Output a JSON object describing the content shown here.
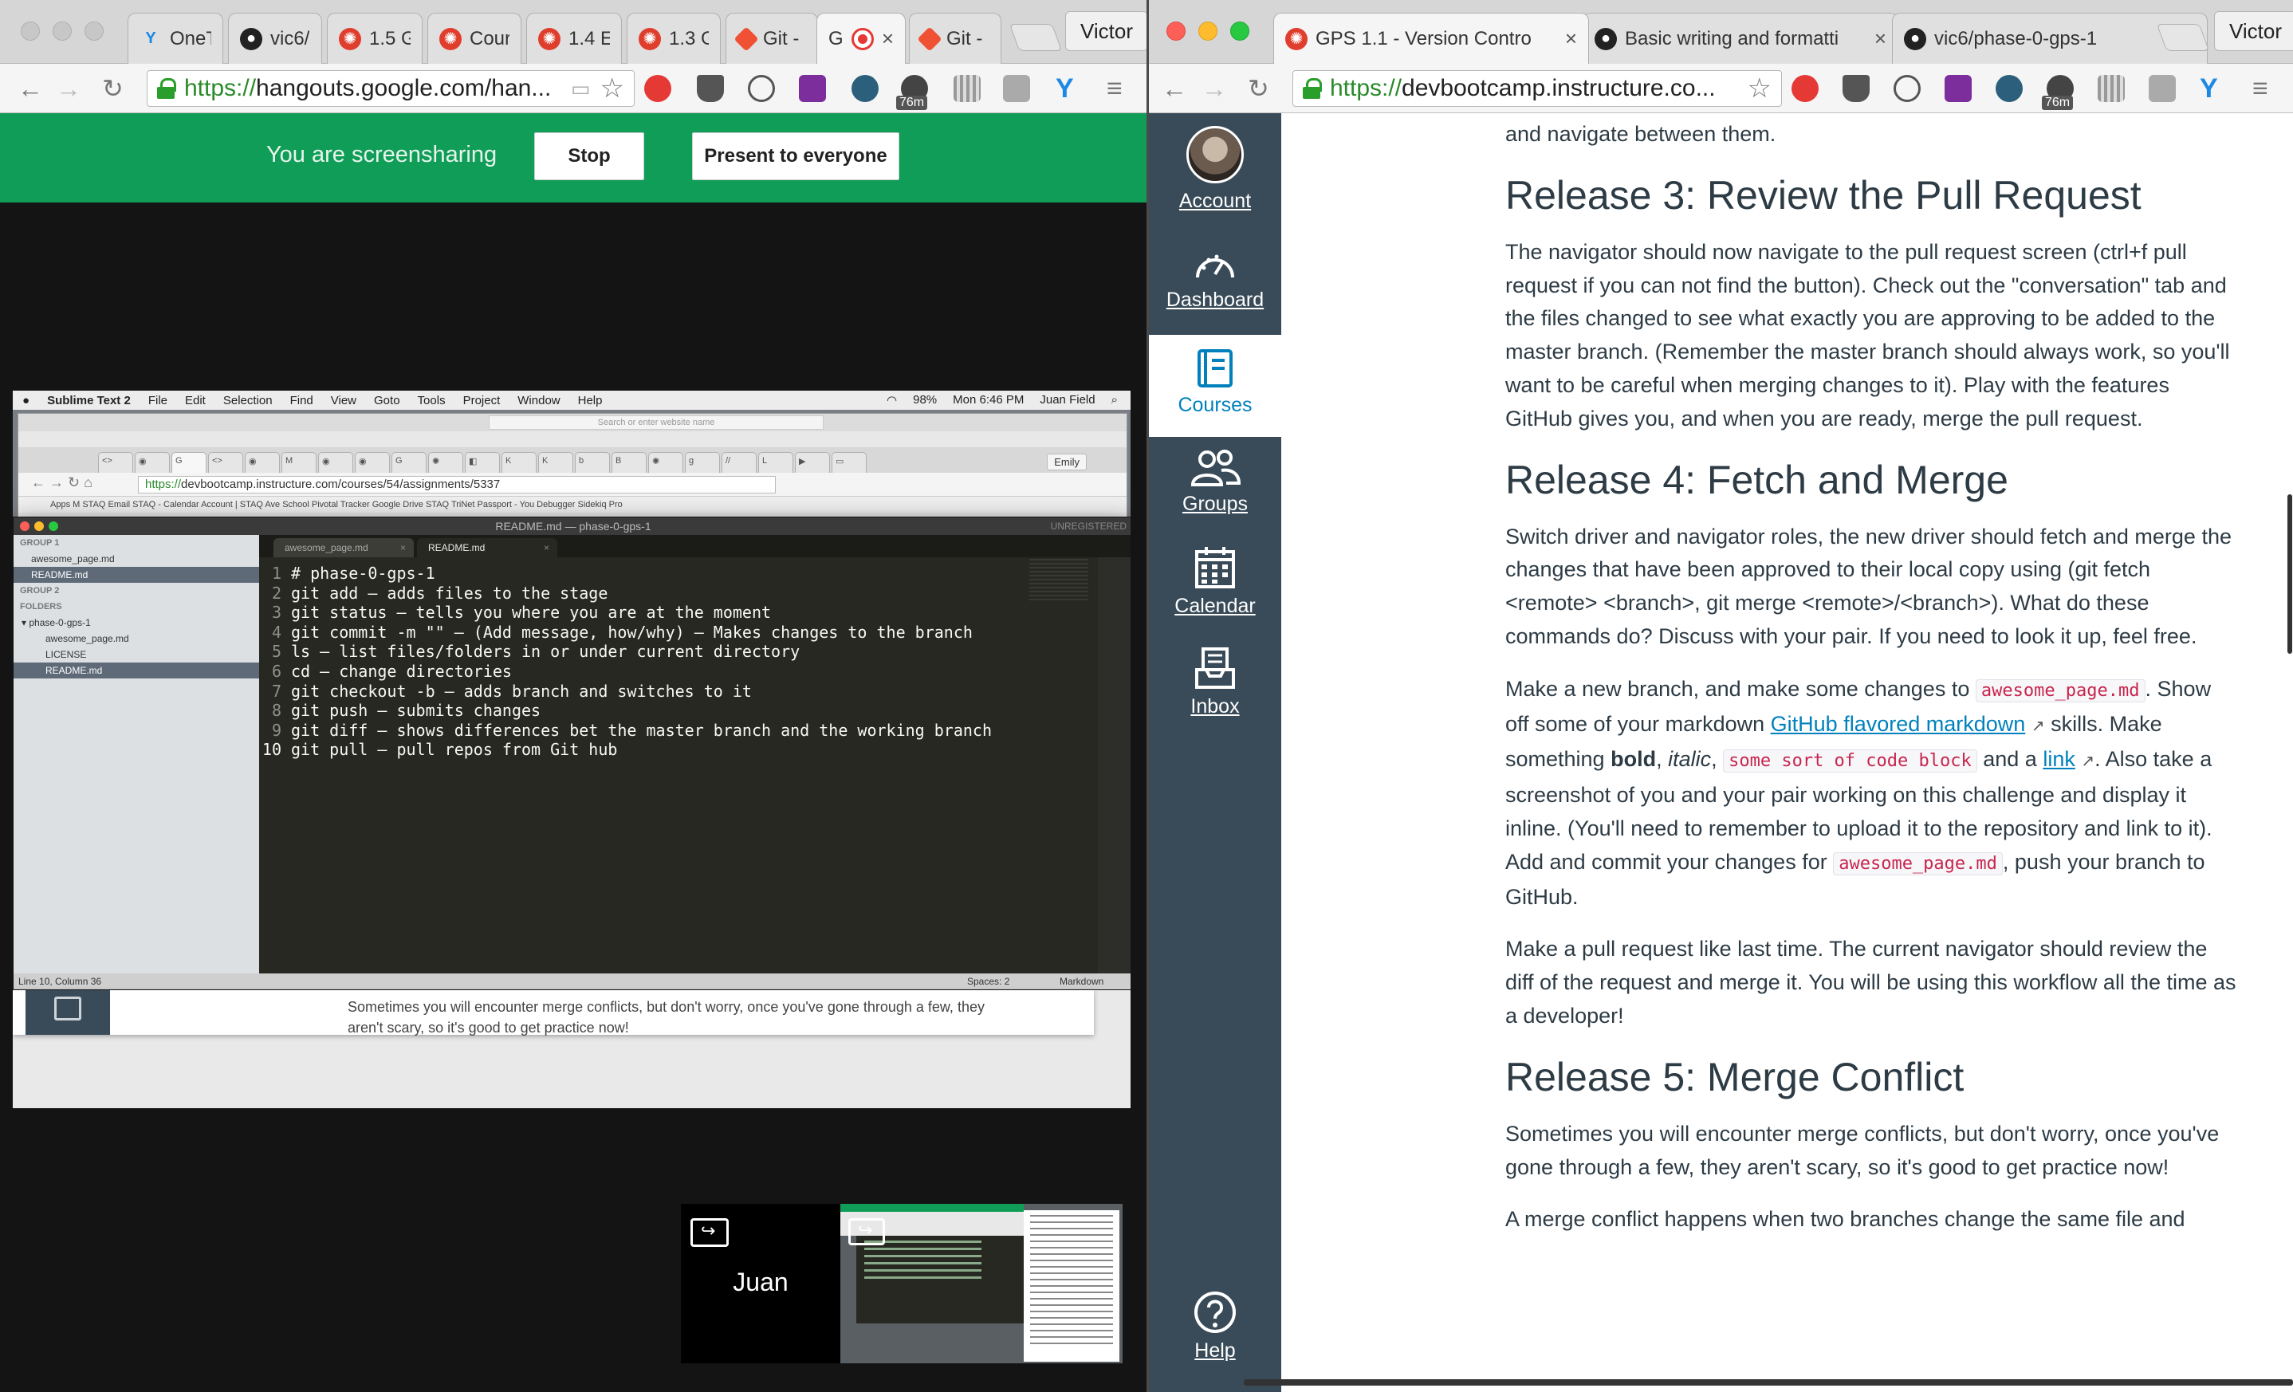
{
  "left_browser": {
    "tabs": [
      {
        "label": "OneT",
        "favicon": "yammer-icon"
      },
      {
        "label": "vic6/",
        "favicon": "github-icon"
      },
      {
        "label": "1.5 G",
        "favicon": "canvas-icon"
      },
      {
        "label": "Cour",
        "favicon": "canvas-icon"
      },
      {
        "label": "1.4 E",
        "favicon": "canvas-icon"
      },
      {
        "label": "1.3 G",
        "favicon": "canvas-icon"
      },
      {
        "label": "Git -",
        "favicon": "git-icon"
      },
      {
        "label": "G",
        "favicon": "hangouts-recording-icon",
        "close": "×"
      },
      {
        "label": "Git -",
        "favicon": "git-icon"
      }
    ],
    "profile": "Victor",
    "url_https": "https://",
    "url_rest": "hangouts.google.com/han...",
    "ext_badge": "76m"
  },
  "hangouts": {
    "share_text": "You are screensharing",
    "stop_label": "Stop",
    "present_label": "Present to everyone",
    "participant_name": "Juan"
  },
  "shared_screen": {
    "menubar": {
      "app": "Sublime Text 2",
      "items": [
        "File",
        "Edit",
        "Selection",
        "Find",
        "View",
        "Goto",
        "Tools",
        "Project",
        "Window",
        "Help"
      ],
      "battery": "98%",
      "clock": "Mon 6:46 PM",
      "user": "Juan Field"
    },
    "inner_browser": {
      "search_placeholder": "Search or enter website name",
      "url_https": "https://",
      "url_rest": "devbootcamp.instructure.com/courses/54/assignments/5337",
      "profile": "Emily",
      "bookmarks": "Apps   M STAQ Email   STAQ - Calendar   Account | STAQ Ave   School   Pivotal Tracker   Google Drive   STAQ   TriNet Passport - You   Debugger   Sidekiq Pro"
    },
    "sublime": {
      "title": "README.md — phase-0-gps-1",
      "unregistered": "UNREGISTERED",
      "sidebar": {
        "group1": "GROUP 1",
        "group1_files": [
          "awesome_page.md",
          "README.md"
        ],
        "group2": "GROUP 2",
        "folders": "FOLDERS",
        "folder_name": "phase-0-gps-1",
        "folder_files": [
          "awesome_page.md",
          "LICENSE",
          "README.md"
        ]
      },
      "tabs": [
        "awesome_page.md",
        "README.md"
      ],
      "tab_close": "×",
      "lines": [
        "# phase-0-gps-1",
        "git add – adds files to the stage",
        "git status – tells you where you are at the moment",
        "git commit -m \"\" – (Add message, how/why) – Makes changes to the branch",
        "ls – list files/folders in or under current directory",
        "cd – change directories",
        "git checkout -b – adds branch and switches to it",
        "git push – submits changes",
        "git diff – shows differences bet the master branch and the working branch",
        "git pull – pull repos from Git hub"
      ],
      "line_numbers": [
        "1",
        "2",
        "3",
        "4",
        "5",
        "6",
        "7",
        "8",
        "9",
        "10"
      ],
      "status_left": "Line 10, Column 36",
      "status_spaces": "Spaces: 2",
      "status_syntax": "Markdown"
    },
    "peek_text_1": "Sometimes you will encounter merge conflicts, but don't worry, once you've gone through a few, they",
    "peek_text_2": "aren't scary, so it's good to get practice now!"
  },
  "right_browser": {
    "tabs": [
      {
        "label": "GPS 1.1 - Version Contro",
        "favicon": "canvas-icon",
        "close": "×"
      },
      {
        "label": "Basic writing and formatti",
        "favicon": "github-icon",
        "close": "×"
      },
      {
        "label": "vic6/phase-0-gps-1",
        "favicon": "github-icon",
        "close": "×"
      }
    ],
    "profile": "Victor",
    "url_https": "https://",
    "url_rest": "devbootcamp.instructure.co...",
    "ext_badge": "76m"
  },
  "canvas_nav": [
    {
      "label": "Account",
      "icon": "avatar"
    },
    {
      "label": "Dashboard",
      "icon": "dashboard-icon"
    },
    {
      "label": "Courses",
      "icon": "courses-icon",
      "active": true
    },
    {
      "label": "Groups",
      "icon": "groups-icon"
    },
    {
      "label": "Calendar",
      "icon": "calendar-icon"
    },
    {
      "label": "Inbox",
      "icon": "inbox-icon"
    },
    {
      "label": "Help",
      "icon": "help-icon"
    }
  ],
  "article": {
    "intro_tail": "and navigate between them.",
    "h_release3": "Release 3: Review the Pull Request",
    "p_release3": "The navigator should now navigate to the pull request screen (ctrl+f pull request if you can not find the button). Check out the \"conversation\" tab and the files changed to see what exactly you are approving to be added to the master branch. (Remember the master branch should always work, so you'll want to be careful when merging changes to it). Play with the features GitHub gives you, and when you are ready, merge the pull request.",
    "h_release4": "Release 4: Fetch and Merge",
    "p_release4": "Switch driver and navigator roles, the new driver should fetch and merge the changes that have been approved to their local copy using (git fetch <remote> <branch>, git merge <remote>/<branch>). What do these commands do? Discuss with your pair. If you need to look it up, feel free.",
    "p_branch": {
      "t1": "Make a new branch, and make some changes to ",
      "code1": "awesome_page.md",
      "t2": ". Show off some of your markdown ",
      "link1": "GitHub flavored markdown",
      "t3": " skills. Make something ",
      "bold": "bold",
      "t4": ", ",
      "italic": "italic",
      "t5": ", ",
      "code2": "some sort of code block",
      "t6": " and a ",
      "link2": "link",
      "t7": ". Also take a screenshot of you and your pair working on this challenge and display it inline. (You'll need to remember to upload it to the repository and link to it). Add and commit your changes for ",
      "code3": "awesome_page.md",
      "t8": ", push your branch to GitHub."
    },
    "p_pr": "Make a pull request like last time. The current navigator should review the diff of the request and merge it. You will be using this workflow all the time as a developer!",
    "h_release5": "Release 5: Merge Conflict",
    "p_release5": "Sometimes you will encounter merge conflicts, but don't worry, once you've gone through a few, they aren't scary, so it's good to get practice now!",
    "p_conflict": "A merge conflict happens when two branches change the same file and"
  }
}
